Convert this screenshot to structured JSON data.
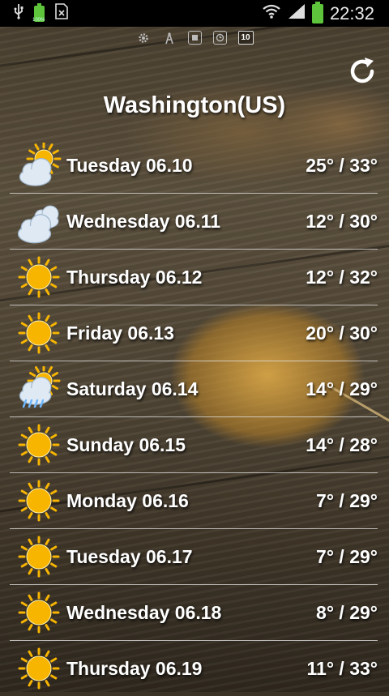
{
  "status_bar": {
    "time": "22:32",
    "battery_small_label": "100%",
    "left_icons": [
      "usb-icon",
      "battery-full-icon",
      "sim-card-icon"
    ],
    "right_icons": [
      "wifi-icon",
      "signal-icon",
      "battery-icon"
    ]
  },
  "indicators": {
    "icons": [
      "gear-icon",
      "tower-icon",
      "square-icon",
      "timer-icon"
    ],
    "badge_number": "10"
  },
  "header": {
    "city": "Washington(US)",
    "refresh_icon": "refresh-icon"
  },
  "forecast": [
    {
      "day": "Tuesday 06.10",
      "temp": "25° / 33°",
      "icon": "partly-cloudy-icon"
    },
    {
      "day": "Wednesday 06.11",
      "temp": "12° / 30°",
      "icon": "cloudy-icon"
    },
    {
      "day": "Thursday 06.12",
      "temp": "12° / 32°",
      "icon": "sunny-icon"
    },
    {
      "day": "Friday 06.13",
      "temp": "20° / 30°",
      "icon": "sunny-icon"
    },
    {
      "day": "Saturday 06.14",
      "temp": "14° / 29°",
      "icon": "rain-icon"
    },
    {
      "day": "Sunday 06.15",
      "temp": "14° / 28°",
      "icon": "sunny-icon"
    },
    {
      "day": "Monday 06.16",
      "temp": "7° / 29°",
      "icon": "sunny-icon"
    },
    {
      "day": "Tuesday 06.17",
      "temp": "7° / 29°",
      "icon": "sunny-icon"
    },
    {
      "day": "Wednesday 06.18",
      "temp": "8° / 29°",
      "icon": "sunny-icon"
    },
    {
      "day": "Thursday 06.19",
      "temp": "11° / 33°",
      "icon": "sunny-icon"
    }
  ],
  "colors": {
    "sun": "#f7b500",
    "cloud": "#dfe9f3",
    "battery": "#5ec43b"
  }
}
